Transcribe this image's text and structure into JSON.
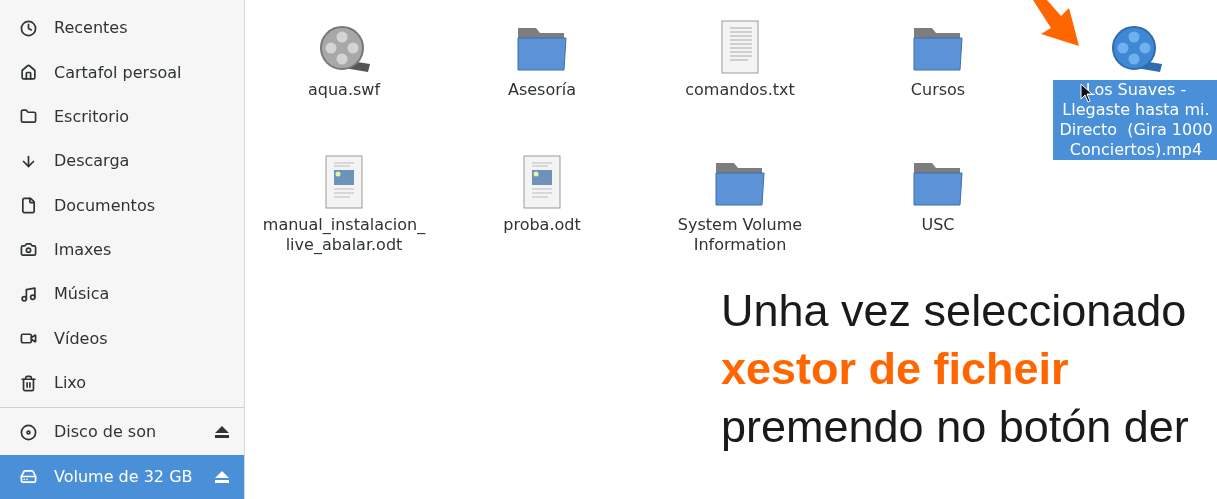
{
  "sidebar": {
    "places": [
      {
        "label": "Recentes",
        "selected": false
      },
      {
        "label": "Cartafol persoal",
        "selected": false
      },
      {
        "label": "Escritorio",
        "selected": false
      },
      {
        "label": "Descarga",
        "selected": false
      },
      {
        "label": "Documentos",
        "selected": false
      },
      {
        "label": "Imaxes",
        "selected": false
      },
      {
        "label": "Música",
        "selected": false
      },
      {
        "label": "Vídeos",
        "selected": false
      },
      {
        "label": "Lixo",
        "selected": false
      }
    ],
    "devices": [
      {
        "label": "Disco de son",
        "selected": false,
        "ejectable": true
      },
      {
        "label": "Volume de 32 GB",
        "selected": true,
        "ejectable": true
      }
    ]
  },
  "files": [
    {
      "name": "aqua.swf",
      "kind": "video",
      "selected": false
    },
    {
      "name": "Asesoría",
      "kind": "folder",
      "selected": false
    },
    {
      "name": "comandos.txt",
      "kind": "text",
      "selected": false
    },
    {
      "name": "Cursos",
      "kind": "folder",
      "selected": false
    },
    {
      "name": "Los Suaves -\nLlegaste hasta mi.\nDirecto  (Gira 1000\nConciertos).mp4",
      "kind": "video",
      "selected": true
    },
    {
      "name": "manual_instalacion_\nlive_abalar.odt",
      "kind": "document",
      "selected": false
    },
    {
      "name": "proba.odt",
      "kind": "document",
      "selected": false
    },
    {
      "name": "System Volume\nInformation",
      "kind": "folder",
      "selected": false
    },
    {
      "name": "USC",
      "kind": "folder",
      "selected": false
    }
  ],
  "slide_text": [
    {
      "text": "Unha vez seleccionado",
      "kind": "normal"
    },
    {
      "text": "xestor de ficheir",
      "kind": "emphasis"
    },
    {
      "text": "premendo no botón der",
      "kind": "normal"
    }
  ]
}
